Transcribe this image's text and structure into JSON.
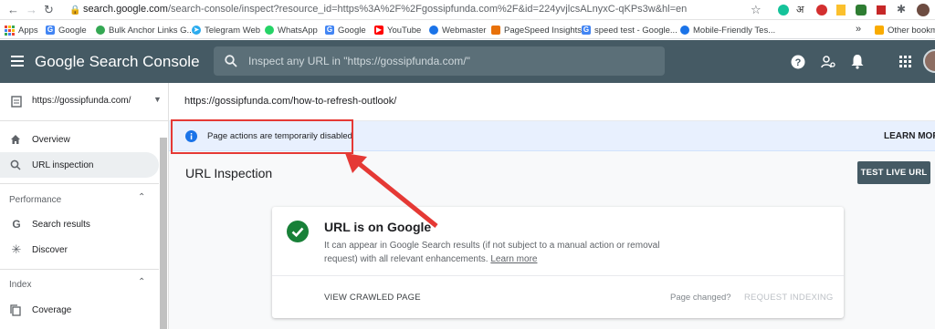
{
  "browser": {
    "url_host": "search.google.com",
    "url_rest": "/search-console/inspect?resource_id=https%3A%2F%2Fgossipfunda.com%2F&id=224yvjlcsALnyxC-qKPs3w&hl=en",
    "bookmarks": [
      {
        "label": "Apps",
        "icon": "apps-grid-icon",
        "color": "#5f6368"
      },
      {
        "label": "Google",
        "icon": "google-g-icon",
        "color": "#4285f4"
      },
      {
        "label": "Bulk Anchor Links G...",
        "icon": "globe-icon",
        "color": "#34a853"
      },
      {
        "label": "Telegram Web",
        "icon": "telegram-icon",
        "color": "#2aabee"
      },
      {
        "label": "WhatsApp",
        "icon": "whatsapp-icon",
        "color": "#25d366"
      },
      {
        "label": "Google",
        "icon": "google-g-icon",
        "color": "#4285f4"
      },
      {
        "label": "YouTube",
        "icon": "youtube-icon",
        "color": "#ff0000"
      },
      {
        "label": "Webmaster",
        "icon": "webmaster-icon",
        "color": "#1a73e8"
      },
      {
        "label": "PageSpeed Insights",
        "icon": "pagespeed-icon",
        "color": "#e8710a"
      },
      {
        "label": "speed test - Google...",
        "icon": "google-g-icon",
        "color": "#4285f4"
      },
      {
        "label": "Mobile-Friendly Tes...",
        "icon": "mobile-friendly-icon",
        "color": "#1a73e8"
      },
      {
        "label": "Other bookmarks",
        "icon": "folder-icon",
        "color": "#f9ab00"
      }
    ],
    "more_glyph": "»"
  },
  "gsc": {
    "logo_google": "Google",
    "logo_product": "Search Console",
    "search_placeholder": "Inspect any URL in \"https://gossipfunda.com/\""
  },
  "sidebar": {
    "property": "https://gossipfunda.com/",
    "items": [
      {
        "label": "Overview",
        "icon": "home-icon"
      },
      {
        "label": "URL inspection",
        "icon": "search-icon",
        "selected": true
      }
    ],
    "performance_heading": "Performance",
    "performance_items": [
      {
        "label": "Search results",
        "icon": "google-g-icon"
      },
      {
        "label": "Discover",
        "icon": "asterisk-icon"
      }
    ],
    "index_heading": "Index",
    "index_items": [
      {
        "label": "Coverage",
        "icon": "copy-icon"
      }
    ]
  },
  "main": {
    "inspected_url": "https://gossipfunda.com/how-to-refresh-outlook/",
    "notice_text": "Page actions are temporarily disabled",
    "learn_more_label": "LEARN MORE",
    "section_title": "URL Inspection",
    "test_live_label": "TEST LIVE URL",
    "card": {
      "status_title": "URL is on Google",
      "description": "It can appear in Google Search results (if not subject to a manual action or removal request) with all relevant enhancements.",
      "learn_more": "Learn more",
      "view_crawled": "VIEW CRAWLED PAGE",
      "page_changed": "Page changed?",
      "request_indexing": "REQUEST INDEXING"
    }
  },
  "colors": {
    "header": "#455a64",
    "notice_bg": "#e8f0fe",
    "info_blue": "#1a73e8",
    "check_green": "#188038",
    "highlight_red": "#e53935"
  }
}
